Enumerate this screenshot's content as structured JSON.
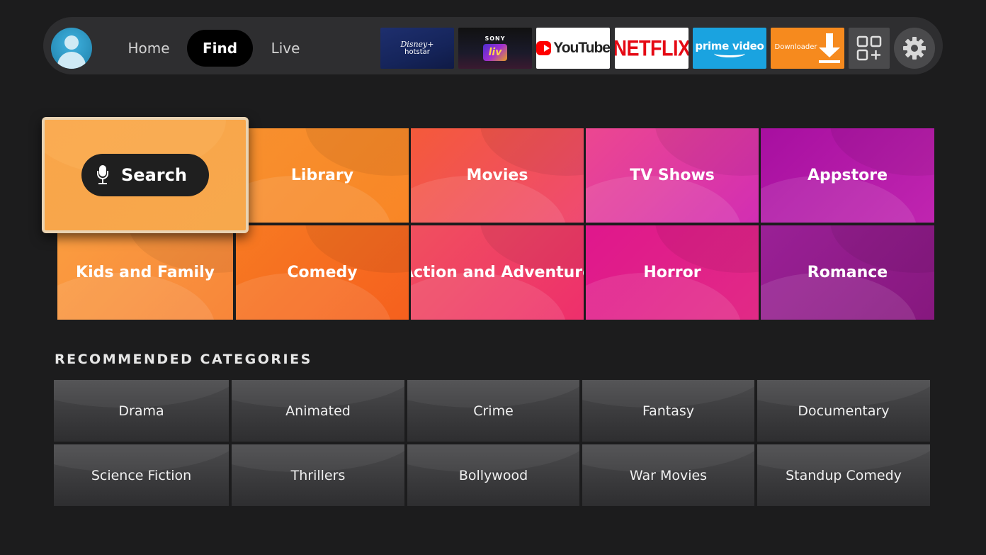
{
  "nav": {
    "home": "Home",
    "find": "Find",
    "live": "Live"
  },
  "apps": {
    "hotstar_line1": "Disney+",
    "hotstar_line2": "hotstar",
    "sonyliv_line1": "SONY",
    "sonyliv_line2": "liv",
    "youtube": "YouTube",
    "netflix": "NETFLIX",
    "prime": "prime video",
    "downloader": "Downloader"
  },
  "search": {
    "label": "Search"
  },
  "categories": [
    {
      "label": "Library"
    },
    {
      "label": "Movies"
    },
    {
      "label": "TV Shows"
    },
    {
      "label": "Appstore"
    },
    {
      "label": "Kids and Family"
    },
    {
      "label": "Comedy"
    },
    {
      "label": "Action and Adventure"
    },
    {
      "label": "Horror"
    },
    {
      "label": "Romance"
    }
  ],
  "recommended": {
    "heading": "RECOMMENDED CATEGORIES",
    "items": [
      {
        "label": "Drama"
      },
      {
        "label": "Animated"
      },
      {
        "label": "Crime"
      },
      {
        "label": "Fantasy"
      },
      {
        "label": "Documentary"
      },
      {
        "label": "Science Fiction"
      },
      {
        "label": "Thrillers"
      },
      {
        "label": "Bollywood"
      },
      {
        "label": "War Movies"
      },
      {
        "label": "Standup Comedy"
      }
    ]
  },
  "colors": {
    "background": "#1c1c1d",
    "topbar": "#2e2e30",
    "focus_border": "#e9d3b3",
    "library": "#f8892a",
    "movies": "#f2545a",
    "tv_shows": "#e5409a",
    "appstore": "#b419a0",
    "kids_and_family": "#f99a3e",
    "comedy": "#f76f22",
    "action_and_adventure": "#f0456a",
    "horror": "#e2238a",
    "romance": "#8e1f8c"
  }
}
